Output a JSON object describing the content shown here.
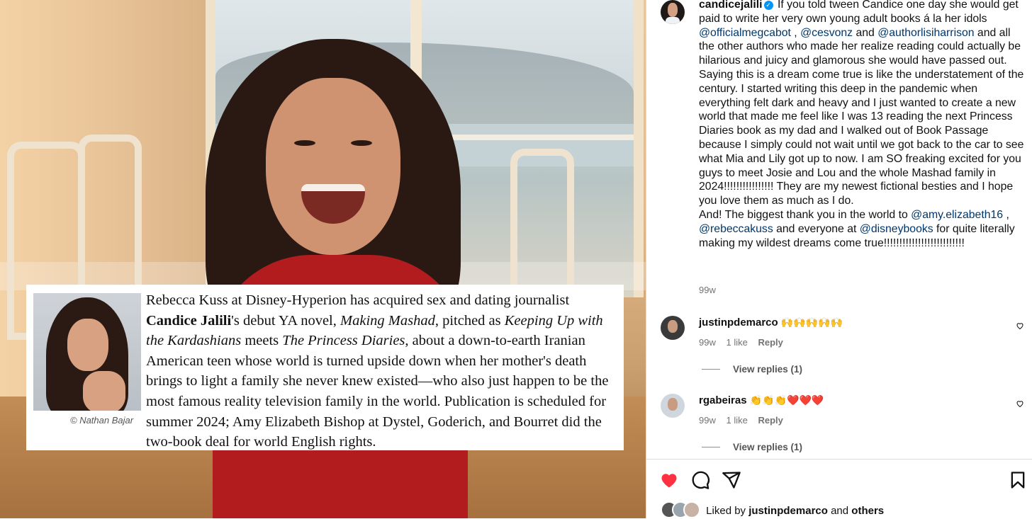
{
  "post": {
    "username": "candicejalili",
    "caption_lines": [
      {
        "t": "If you told tween Candice one day she would get paid to write her very own young adult books á la her idols "
      },
      {
        "m": "@officialmegcabot"
      },
      {
        "t": " , "
      },
      {
        "m": "@cesvonz"
      },
      {
        "t": " and "
      },
      {
        "m": "@authorlisiharrison"
      },
      {
        "t": " and all the other authors who made her realize reading could actually be hilarious and juicy and glamorous she would have passed out. Saying this is a dream come true is like the understatement of the century. I started writing this deep in the pandemic when everything felt dark and heavy and I just wanted to create a new world that made me feel like I was 13 reading the next Princess Diaries book as my dad and I walked out of Book Passage because I simply could not wait until we got back to the car to see what Mia and Lily got up to now. I am SO freaking excited for you guys to meet Josie and Lou and the whole Mashad family in 2024!!!!!!!!!!!!!!!! They are my newest fictional besties and I hope you love them as much as I do."
      }
    ],
    "caption2": [
      {
        "t": "And! The biggest thank you in the world to "
      },
      {
        "m": "@amy.elizabeth16"
      },
      {
        "t": " , "
      },
      {
        "m": "@rebeccakuss"
      },
      {
        "t": " and everyone at "
      },
      {
        "m": "@disneybooks"
      },
      {
        "t": " for quite literally making my wildest dreams come true!!!!!!!!!!!!!!!!!!!!!!!!!!"
      }
    ],
    "time": "99w"
  },
  "clipping": {
    "credit": "© Nathan Bajar",
    "segments": [
      {
        "t": "Rebecca Kuss at Disney-Hyperion has acquired sex and dating journalist "
      },
      {
        "b": "Candice Jalili"
      },
      {
        "t": "'s debut YA novel, "
      },
      {
        "i": "Making Mashad"
      },
      {
        "t": ", pitched as "
      },
      {
        "i": "Keeping Up with the Kardashians"
      },
      {
        "t": " meets "
      },
      {
        "i": "The Princess Diaries"
      },
      {
        "t": ", about a down-to-earth Iranian American teen whose world is turned upside down when her mother's death brings to light a family she never knew existed—who also just happen to be the most famous reality television family in the world. Publication is scheduled for summer 2024; Amy Elizabeth Bishop at Dystel, Goderich, and Bourret did the two-book deal for world English rights."
      }
    ]
  },
  "comments": [
    {
      "user": "justinpdemarco",
      "emoji": "🙌🙌🙌🙌🙌",
      "time": "99w",
      "likes": "1 like",
      "reply": "Reply",
      "view_replies": "View replies (1)"
    },
    {
      "user": "rgabeiras",
      "emoji": "👏👏👏❤️❤️❤️",
      "time": "99w",
      "likes": "1 like",
      "reply": "Reply",
      "view_replies": "View replies (1)"
    }
  ],
  "liked_by": {
    "prefix": "Liked by",
    "user": "justinpdemarco",
    "and": "and",
    "others": "others"
  },
  "colors": {
    "heart": "#ff3040",
    "mention": "#00376b",
    "meta": "#737373"
  },
  "icons": [
    "heart-icon",
    "comment-icon",
    "share-icon",
    "bookmark-icon",
    "verified-icon"
  ]
}
